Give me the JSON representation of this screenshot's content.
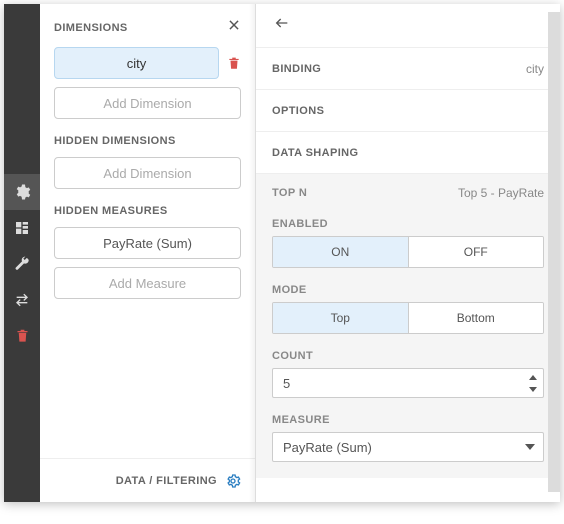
{
  "left": {
    "title": "DIMENSIONS",
    "dimension_item": "city",
    "add_dimension": "Add Dimension",
    "hidden_dimensions_title": "HIDDEN DIMENSIONS",
    "hidden_measures_title": "HIDDEN MEASURES",
    "measure_item": "PayRate (Sum)",
    "add_measure": "Add Measure",
    "footer": "DATA / FILTERING"
  },
  "right": {
    "binding_label": "BINDING",
    "binding_value": "city",
    "options_label": "OPTIONS",
    "data_shaping_label": "DATA SHAPING",
    "topn_label": "TOP N",
    "topn_value": "Top 5 - PayRate",
    "enabled_label": "ENABLED",
    "on": "ON",
    "off": "OFF",
    "mode_label": "MODE",
    "mode_top": "Top",
    "mode_bottom": "Bottom",
    "count_label": "COUNT",
    "count_value": "5",
    "measure_label": "MEASURE",
    "measure_value": "PayRate (Sum)"
  }
}
